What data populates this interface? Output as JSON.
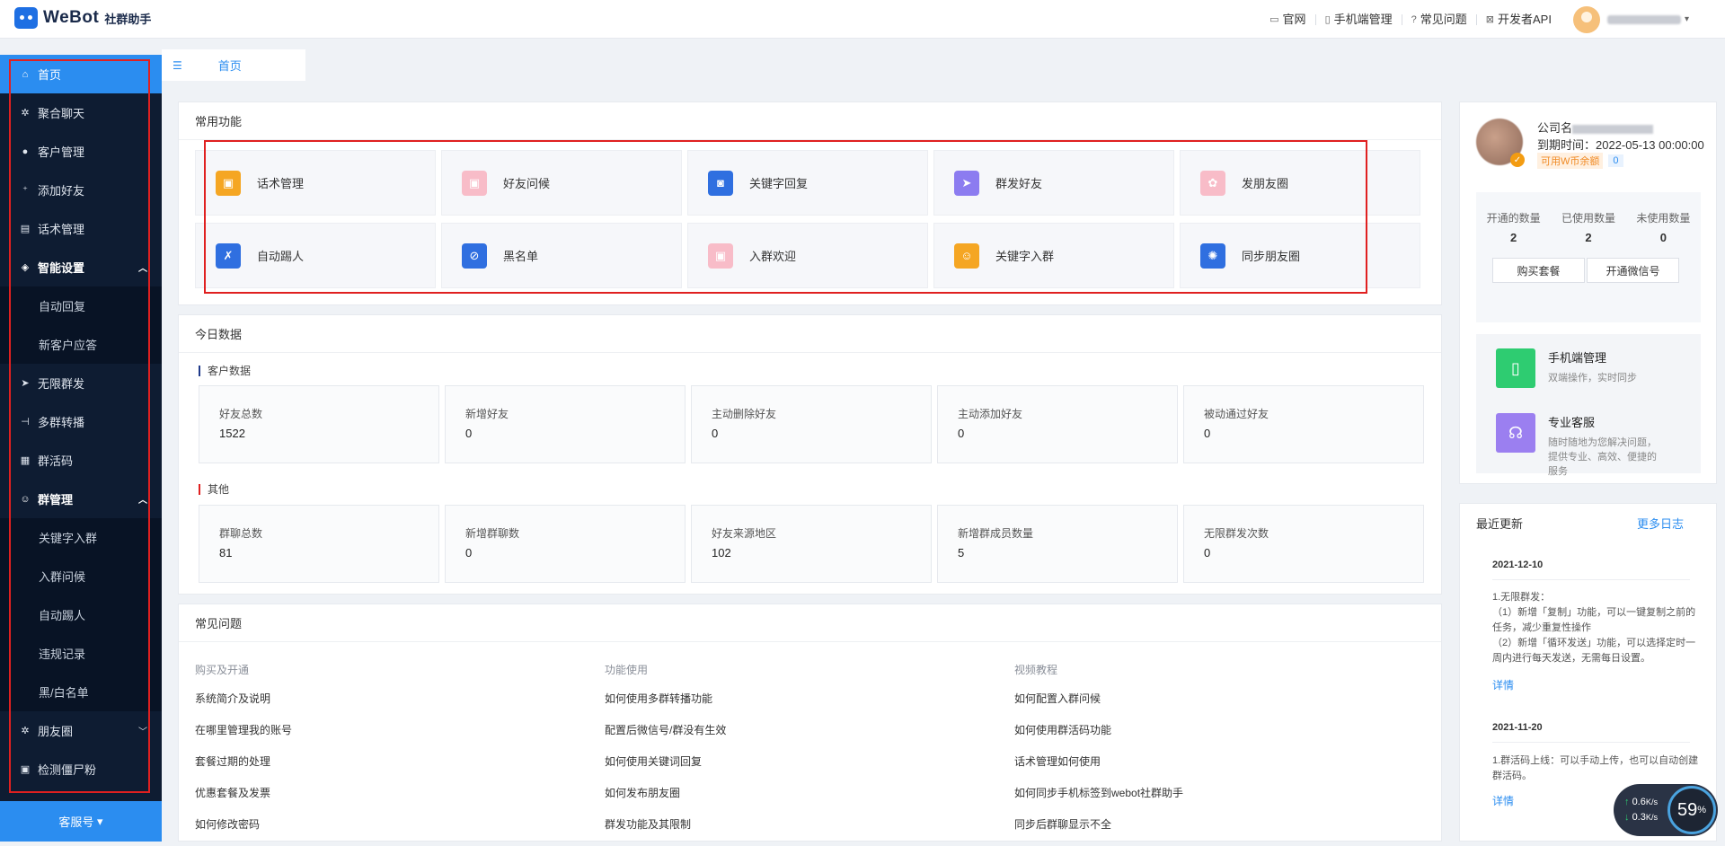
{
  "header": {
    "logo_text": "WeBot",
    "logo_sub": "社群助手",
    "links": [
      {
        "icon": "monitor-icon",
        "label": "官网"
      },
      {
        "icon": "phone-icon",
        "label": "手机端管理"
      },
      {
        "icon": "question-icon",
        "label": "常见问题"
      },
      {
        "icon": "api-icon",
        "label": "开发者API"
      }
    ]
  },
  "sidebar": {
    "items": [
      {
        "label": "首页",
        "icon": "home-icon",
        "active": true
      },
      {
        "label": "聚合聊天",
        "icon": "gear-icon"
      },
      {
        "label": "客户管理",
        "icon": "user-icon"
      },
      {
        "label": "添加好友",
        "icon": "add-user-icon"
      },
      {
        "label": "话术管理",
        "icon": "document-icon"
      },
      {
        "label": "智能设置",
        "icon": "smart-icon",
        "group": true,
        "expanded": true
      },
      {
        "label": "自动回复",
        "sub": true
      },
      {
        "label": "新客户应答",
        "sub": true
      },
      {
        "label": "无限群发",
        "icon": "send-icon"
      },
      {
        "label": "多群转播",
        "icon": "broadcast-icon"
      },
      {
        "label": "群活码",
        "icon": "qrcode-icon"
      },
      {
        "label": "群管理",
        "icon": "group-icon",
        "group": true,
        "expanded": true
      },
      {
        "label": "关键字入群",
        "sub": true
      },
      {
        "label": "入群问候",
        "sub": true
      },
      {
        "label": "自动踢人",
        "sub": true
      },
      {
        "label": "违规记录",
        "sub": true
      },
      {
        "label": "黑/白名单",
        "sub": true
      },
      {
        "label": "朋友圈",
        "icon": "moments-icon",
        "collapsed": true
      },
      {
        "label": "检测僵尸粉",
        "icon": "detect-icon"
      }
    ],
    "footer_label": "客服号"
  },
  "tabs": [
    {
      "label": "首页"
    }
  ],
  "common_functions": {
    "title": "常用功能",
    "items": [
      {
        "label": "话术管理",
        "icon": "script-icon",
        "color": "#f5a623"
      },
      {
        "label": "好友问候",
        "icon": "greeting-icon",
        "color": "#f8bcc8"
      },
      {
        "label": "关键字回复",
        "icon": "robot-icon",
        "color": "#2f6fe0"
      },
      {
        "label": "群发好友",
        "icon": "paper-plane-icon",
        "color": "#8c7cf0"
      },
      {
        "label": "发朋友圈",
        "icon": "camera-icon",
        "color": "#f8bcc8"
      },
      {
        "label": "自动踢人",
        "icon": "kick-user-icon",
        "color": "#2f6fe0"
      },
      {
        "label": "黑名单",
        "icon": "blacklist-icon",
        "color": "#2f6fe0"
      },
      {
        "label": "入群欢迎",
        "icon": "welcome-icon",
        "color": "#f8bcc8"
      },
      {
        "label": "关键字入群",
        "icon": "keyword-group-icon",
        "color": "#f5a623"
      },
      {
        "label": "同步朋友圈",
        "icon": "sync-icon",
        "color": "#2f6fe0"
      }
    ]
  },
  "today_data": {
    "title": "今日数据",
    "customer": {
      "title": "客户数据",
      "bar_color": "#1f3a8a",
      "stats": [
        {
          "label": "好友总数",
          "value": "1522"
        },
        {
          "label": "新增好友",
          "value": "0"
        },
        {
          "label": "主动删除好友",
          "value": "0"
        },
        {
          "label": "主动添加好友",
          "value": "0"
        },
        {
          "label": "被动通过好友",
          "value": "0"
        }
      ]
    },
    "other": {
      "title": "其他",
      "bar_color": "#e02020",
      "stats": [
        {
          "label": "群聊总数",
          "value": "81"
        },
        {
          "label": "新增群聊数",
          "value": "0"
        },
        {
          "label": "好友来源地区",
          "value": "102"
        },
        {
          "label": "新增群成员数量",
          "value": "5"
        },
        {
          "label": "无限群发次数",
          "value": "0"
        }
      ]
    }
  },
  "faq": {
    "title": "常见问题",
    "columns": [
      {
        "head": "购买及开通",
        "links": [
          "系统简介及说明",
          "在哪里管理我的账号",
          "套餐过期的处理",
          "优惠套餐及发票",
          "如何修改密码"
        ]
      },
      {
        "head": "功能使用",
        "links": [
          "如何使用多群转播功能",
          "配置后微信号/群没有生效",
          "如何使用关键词回复",
          "如何发布朋友圈",
          "群发功能及其限制"
        ]
      },
      {
        "head": "视频教程",
        "links": [
          "如何配置入群问候",
          "如何使用群活码功能",
          "话术管理如何使用",
          "如何同步手机标签到webot社群助手",
          "同步后群聊显示不全"
        ]
      }
    ]
  },
  "account": {
    "company_label": "公司名",
    "expire": "到期时间：2022-05-13 00:00:00",
    "coin_label": "可用W币余额",
    "coin_value": "0",
    "quota": [
      {
        "label": "开通的数量",
        "value": "2"
      },
      {
        "label": "已使用数量",
        "value": "2"
      },
      {
        "label": "未使用数量",
        "value": "0"
      }
    ],
    "buy_button": "购买套餐",
    "open_button": "开通微信号"
  },
  "promos": [
    {
      "title": "手机端管理",
      "desc": "双端操作，实时同步",
      "icon": "tablet-icon",
      "color": "#2ecc71"
    },
    {
      "title": "专业客服",
      "desc": "随时随地为您解决问题，提供专业、高效、便捷的服务",
      "icon": "headset-icon",
      "color": "#9b7ff0"
    }
  ],
  "updates": {
    "title": "最近更新",
    "more": "更多日志",
    "entries": [
      {
        "date": "2021-12-10",
        "text": "1.无限群发：\n（1）新增「复制」功能，可以一键复制之前的任务，减少重复性操作\n（2）新增「循环发送」功能，可以选择定时一周内进行每天发送，无需每日设置。",
        "link": "详情"
      },
      {
        "date": "2021-11-20",
        "text": "1.群活码上线：可以手动上传，也可以自动创建群活码。",
        "link": "详情"
      }
    ]
  },
  "net_meter": {
    "up": "0.6",
    "down": "0.3",
    "unit": "K/s",
    "percent": "59",
    "percent_sign": "%"
  }
}
